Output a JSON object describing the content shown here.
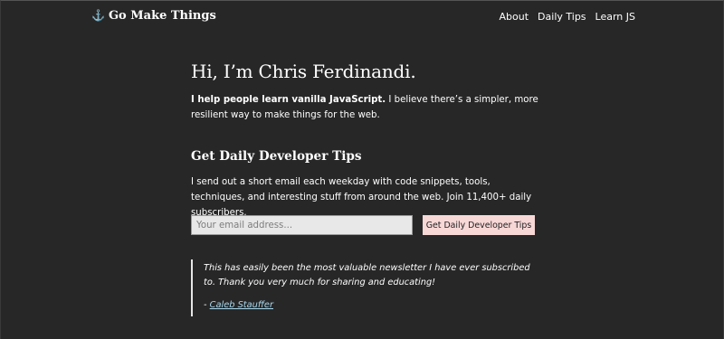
{
  "header": {
    "logo_icon": "anchor-icon",
    "logo_text": "Go Make Things",
    "nav": [
      {
        "label": "About"
      },
      {
        "label": "Daily Tips"
      },
      {
        "label": "Learn JS"
      }
    ]
  },
  "hero": {
    "title": "Hi, I’m Chris Ferdinandi.",
    "intro_bold": "I help people learn vanilla JavaScript.",
    "intro_rest": " I believe there’s a simpler, more resilient way to make things for the web."
  },
  "tips": {
    "heading": "Get Daily Developer Tips",
    "description": "I send out a short email each weekday with code snippets, tools, techniques, and interesting stuff from around the web. Join 11,400+ daily subscribers."
  },
  "signup": {
    "email_placeholder": "Your email address...",
    "email_value": "",
    "button_label": "Get Daily Developer Tips"
  },
  "testimonial": {
    "quote": "This has easily been the most valuable newsletter I have ever subscribed to. Thank you very much for sharing and educating!",
    "dash": "- ",
    "author": "Caleb Stauffer"
  },
  "colors": {
    "background": "#272727",
    "text": "#ffffff",
    "button_bg": "#f8d7d7",
    "link": "#a8d8ee"
  }
}
